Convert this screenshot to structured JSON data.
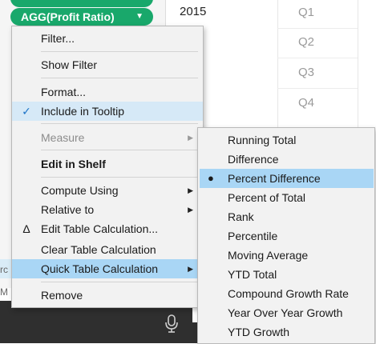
{
  "shelf": {
    "pill_label": "AGG(Profit Ratio)",
    "pill_caret": "▼"
  },
  "table": {
    "year": "2015",
    "quarters": [
      "Q1",
      "Q2",
      "Q3",
      "Q4"
    ]
  },
  "left_slivers": [
    "rc",
    "M"
  ],
  "menu": {
    "items": [
      {
        "label": "Filter...",
        "disabled": false
      },
      {
        "label": "Show Filter",
        "disabled": false
      },
      {
        "label": "Format...",
        "disabled": false
      },
      {
        "label": "Include in Tooltip",
        "checked": true
      },
      {
        "label": "Measure",
        "disabled": true,
        "submenu": true
      },
      {
        "label": "Edit in Shelf",
        "bold": true
      },
      {
        "label": "Compute Using",
        "submenu": true
      },
      {
        "label": "Relative to",
        "submenu": true
      },
      {
        "label": "Edit Table Calculation...",
        "icon": "delta-icon"
      },
      {
        "label": "Clear Table Calculation"
      },
      {
        "label": "Quick Table Calculation",
        "submenu": true,
        "highlighted": true
      },
      {
        "label": "Remove"
      }
    ],
    "icons": {
      "check": "✓",
      "delta": "Δ",
      "submenu_arrow": "▶"
    }
  },
  "submenu": {
    "items": [
      {
        "label": "Running Total"
      },
      {
        "label": "Difference"
      },
      {
        "label": "Percent Difference",
        "selected": true
      },
      {
        "label": "Percent of Total"
      },
      {
        "label": "Rank"
      },
      {
        "label": "Percentile"
      },
      {
        "label": "Moving Average"
      },
      {
        "label": "YTD Total"
      },
      {
        "label": "Compound Growth Rate"
      },
      {
        "label": "Year Over Year Growth"
      },
      {
        "label": "YTD Growth"
      }
    ],
    "bullet": "●"
  },
  "colors": {
    "pill": "#19a86b",
    "highlight": "#a9d6f5",
    "menu_bg": "#f2f2f2",
    "dark_bar": "#2f2f2f"
  }
}
